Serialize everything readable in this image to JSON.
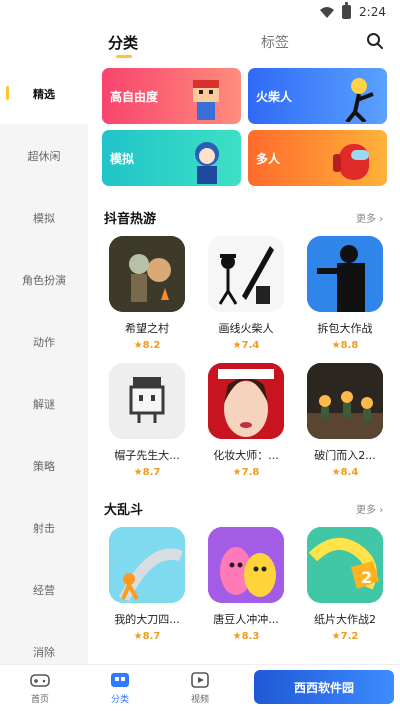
{
  "status": {
    "time": "2:24"
  },
  "header": {
    "tab_category": "分类",
    "tab_tags": "标签"
  },
  "sidebar": {
    "items": [
      {
        "label": "精选"
      },
      {
        "label": "超休闲"
      },
      {
        "label": "模拟"
      },
      {
        "label": "角色扮演"
      },
      {
        "label": "动作"
      },
      {
        "label": "解谜"
      },
      {
        "label": "策略"
      },
      {
        "label": "射击"
      },
      {
        "label": "经营"
      },
      {
        "label": "消除"
      }
    ]
  },
  "banners": [
    {
      "label": "高自由度",
      "color": "#f8436e"
    },
    {
      "label": "火柴人",
      "color": "#2f6af7"
    },
    {
      "label": "模拟",
      "color": "#20c4c9"
    },
    {
      "label": "多人",
      "color": "#ff6b2c"
    }
  ],
  "section1": {
    "title": "抖音热游",
    "more": "更多",
    "games": [
      {
        "name": "希望之村",
        "rating": "8.2"
      },
      {
        "name": "画线火柴人",
        "rating": "7.4"
      },
      {
        "name": "拆包大作战",
        "rating": "8.8"
      },
      {
        "name": "帽子先生大...",
        "rating": "8.7"
      },
      {
        "name": "化妆大师：...",
        "rating": "7.8"
      },
      {
        "name": "破门而入2...",
        "rating": "8.4"
      }
    ]
  },
  "section2": {
    "title": "大乱斗",
    "more": "更多",
    "games": [
      {
        "name": "我的大刀四...",
        "rating": "8.7"
      },
      {
        "name": "唐豆人冲冲...",
        "rating": "8.3"
      },
      {
        "name": "纸片大作战2",
        "rating": "7.2"
      }
    ]
  },
  "bottomnav": {
    "items": [
      {
        "label": "首页"
      },
      {
        "label": "分类"
      },
      {
        "label": "视频"
      }
    ]
  },
  "watermark": {
    "text": "西西软件园"
  }
}
